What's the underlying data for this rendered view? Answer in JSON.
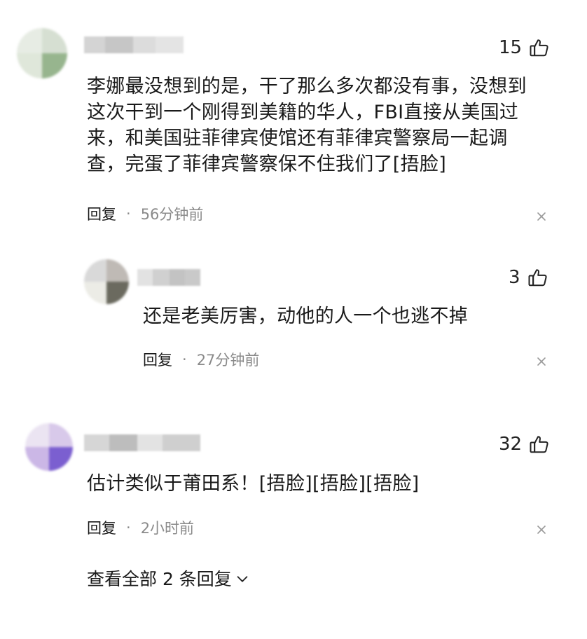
{
  "comments": [
    {
      "likes": "15",
      "text_lines": [
        "李娜最没想到的是，干了那么多次都没有事，没想到",
        "这次干到一个刚得到美籍的华人，FBI直接从美国过",
        "来，和美国驻菲律宾使馆还有菲律宾警察局一起调",
        "查，完蛋了菲律宾警察保不住我们了[捂脸]"
      ],
      "reply_label": "回复",
      "separator": "·",
      "time": "56分钟前"
    },
    {
      "likes": "3",
      "text_lines": [
        "还是老美厉害，动他的人一个也逃不掉"
      ],
      "reply_label": "回复",
      "separator": "·",
      "time": "27分钟前"
    },
    {
      "likes": "32",
      "text_lines": [
        "估计类似于莆田系！[捂脸][捂脸][捂脸]"
      ],
      "reply_label": "回复",
      "separator": "·",
      "time": "2小时前"
    }
  ],
  "view_all_replies": "查看全部 2 条回复",
  "icons": {
    "like": "thumbs-up-icon",
    "close": "close-icon",
    "expand": "chevron-down-icon"
  },
  "colors": {
    "text": "#1a1a1a",
    "muted": "#8a8a8a",
    "background": "#ffffff"
  }
}
